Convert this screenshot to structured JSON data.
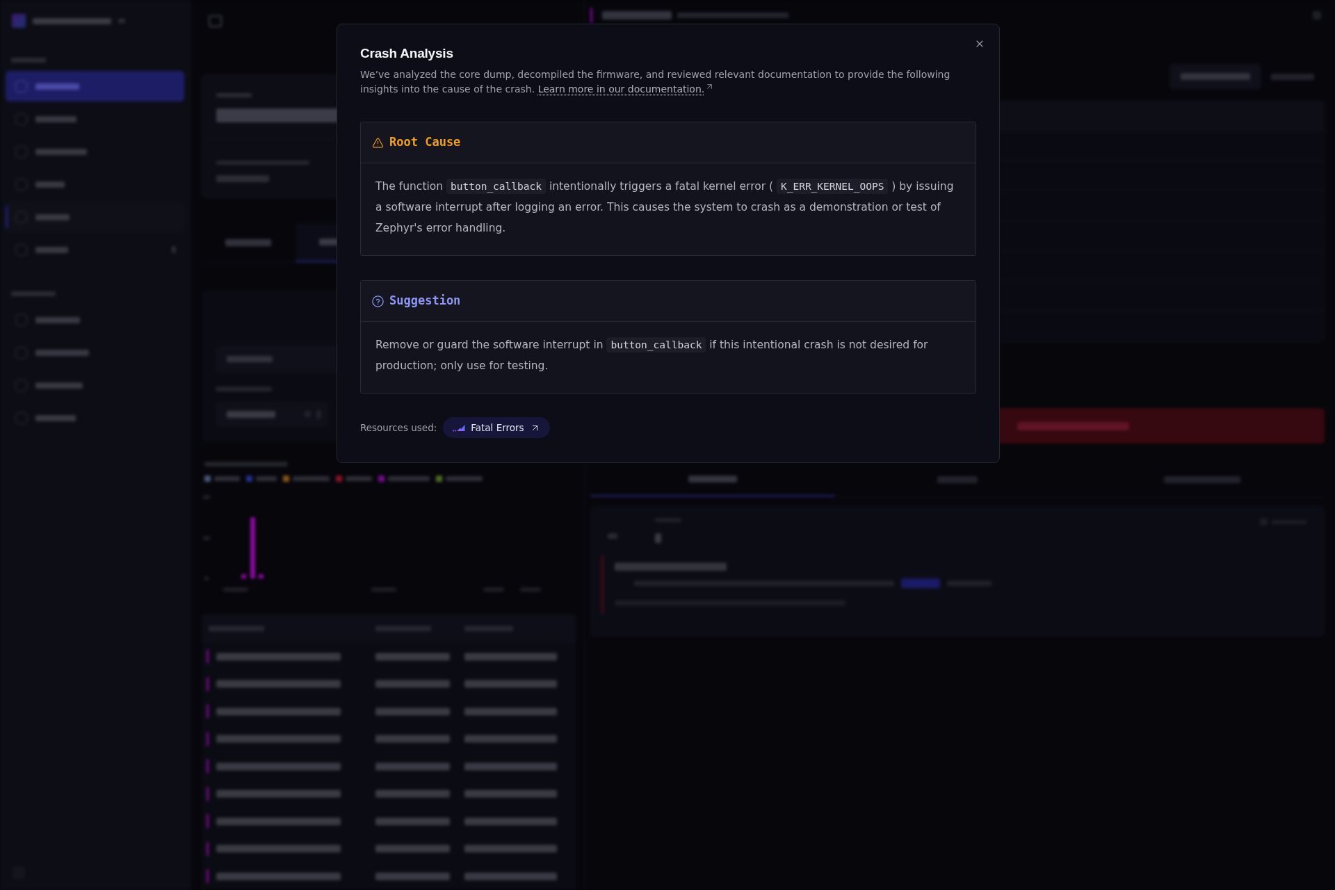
{
  "crash_analysis": {
    "title": "Crash Analysis",
    "description": "We’ve analyzed the core dump, decompiled the firmware, and reviewed relevant documentation to provide the following insights into the cause of the crash.",
    "link": "Learn more in our documentation.",
    "sections": [
      {
        "kind": "root_cause",
        "title": "Root Cause",
        "body": [
          {
            "kind": "text",
            "text": "The function "
          },
          {
            "kind": "code",
            "text": "button_callback"
          },
          {
            "kind": "text",
            "text": " intentionally triggers a fatal kernel error ( "
          },
          {
            "kind": "code",
            "text": "K_ERR_KERNEL_OOPS"
          },
          {
            "kind": "text",
            "text": " ) by issuing a software interrupt after logging an error. This causes the system to crash as a demonstration or test of Zephyr's error handling."
          }
        ]
      },
      {
        "kind": "suggestion",
        "title": "Suggestion",
        "body": [
          {
            "kind": "text",
            "text": "Remove or guard the software interrupt in "
          },
          {
            "kind": "code",
            "text": "button_callback"
          },
          {
            "kind": "text",
            "text": " if this intentional crash is not desired for production; only use for testing."
          }
        ]
      }
    ],
    "resources_label": "Resources used:",
    "resources": [
      {
        "label": "Fatal Errors"
      }
    ]
  }
}
